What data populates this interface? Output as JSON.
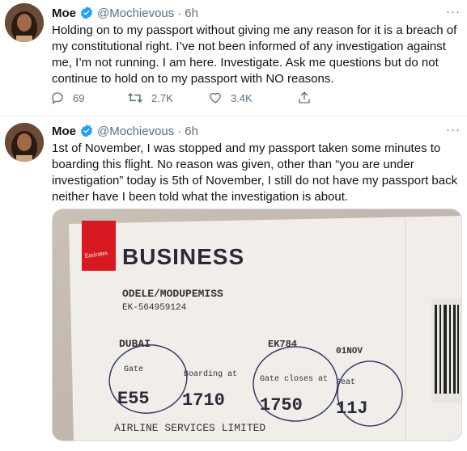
{
  "tweets": [
    {
      "name": "Moe",
      "handle": "@Mochievous",
      "dot": "·",
      "time": "6h",
      "more": "···",
      "text": "Holding on to my passport without giving me any reason for it is a breach of my constitutional right. I’ve not been informed of any investigation against me, I’m not running. I am here. Investigate. Ask me questions but do not continue to hold on to my passport with NO reasons.",
      "replies": "69",
      "retweets": "2.7K",
      "likes": "3.4K"
    },
    {
      "name": "Moe",
      "handle": "@Mochievous",
      "dot": "·",
      "time": "6h",
      "more": "···",
      "text": "1st of November, I was stopped and my passport taken some minutes to boarding this flight. No reason was given, other than “you are under investigation” today is 5th of November, I still do not have my passport back neither have I been told what the investigation is about."
    }
  ],
  "boarding_pass": {
    "logo_text": "Emirates",
    "class_label": "BUSINESS",
    "passenger": "ODELE/MODUPEMISS",
    "ticket": "EK-564959124",
    "destination": "DUBAI",
    "flight": "EK784",
    "date": "01NOV",
    "gate_label": "Gate",
    "gate_value": "E55",
    "boarding_label": "Boarding at",
    "boarding_value": "1710",
    "gate_closes_label": "Gate closes at",
    "gate_closes_value": "1750",
    "seat_label": "Seat",
    "seat_value": "11J",
    "footer": "AIRLINE SERVICES LIMITED"
  },
  "colors": {
    "verified": "#1da1f2",
    "muted": "#5b7083",
    "emirates_red": "#d71921"
  }
}
